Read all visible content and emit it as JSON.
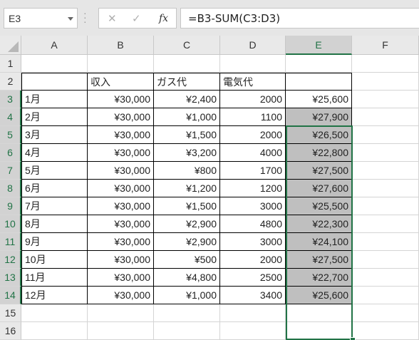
{
  "name_box": {
    "value": "E3"
  },
  "formula_bar": {
    "cancel_symbol": "✕",
    "enter_symbol": "✓",
    "fx_label": "fx",
    "formula": "=B3-SUM(C3:D3)"
  },
  "columns": [
    "A",
    "B",
    "C",
    "D",
    "E",
    "F"
  ],
  "rows": [
    "1",
    "2",
    "3",
    "4",
    "5",
    "6",
    "7",
    "8",
    "9",
    "10",
    "11",
    "12",
    "13",
    "14",
    "15",
    "16"
  ],
  "table": {
    "headers": [
      "",
      "収入",
      "ガス代",
      "電気代",
      ""
    ],
    "data": [
      [
        "1月",
        "¥30,000",
        "¥2,400",
        "2000",
        "¥25,600"
      ],
      [
        "2月",
        "¥30,000",
        "¥1,000",
        "1100",
        "¥27,900"
      ],
      [
        "3月",
        "¥30,000",
        "¥1,500",
        "2000",
        "¥26,500"
      ],
      [
        "4月",
        "¥30,000",
        "¥3,200",
        "4000",
        "¥22,800"
      ],
      [
        "5月",
        "¥30,000",
        "¥800",
        "1700",
        "¥27,500"
      ],
      [
        "6月",
        "¥30,000",
        "¥1,200",
        "1200",
        "¥27,600"
      ],
      [
        "7月",
        "¥30,000",
        "¥1,500",
        "3000",
        "¥25,500"
      ],
      [
        "8月",
        "¥30,000",
        "¥2,900",
        "4800",
        "¥22,300"
      ],
      [
        "9月",
        "¥30,000",
        "¥2,900",
        "3000",
        "¥24,100"
      ],
      [
        "10月",
        "¥30,000",
        "¥500",
        "2000",
        "¥27,500"
      ],
      [
        "11月",
        "¥30,000",
        "¥4,800",
        "2500",
        "¥22,700"
      ],
      [
        "12月",
        "¥30,000",
        "¥1,000",
        "3400",
        "¥25,600"
      ]
    ]
  },
  "selection": {
    "range": "E3:E14",
    "accent": "#217346",
    "fill": "#bfbfbf"
  }
}
